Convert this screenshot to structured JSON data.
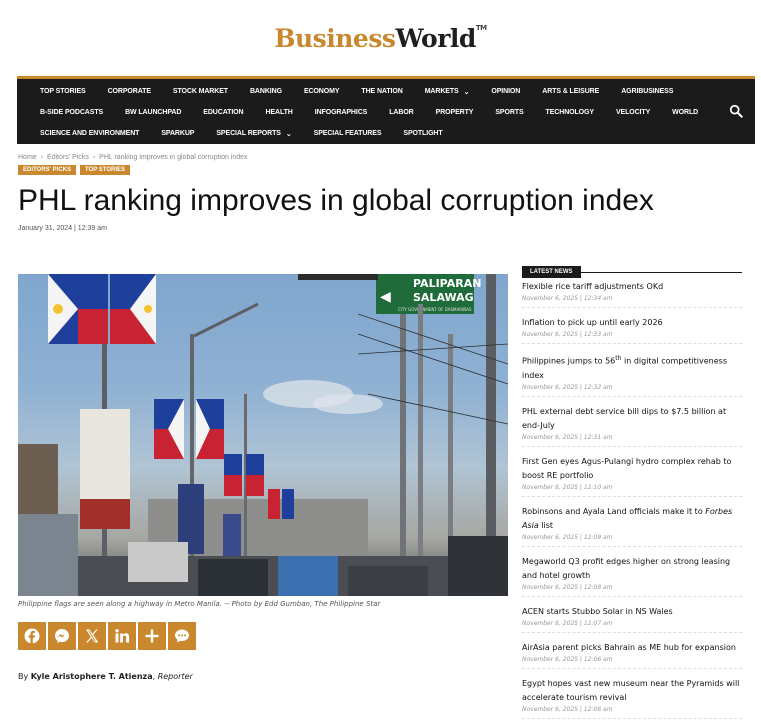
{
  "brand": {
    "part1": "Business",
    "part2": "World",
    "tm": "TM"
  },
  "nav": {
    "row1": [
      "TOP STORIES",
      "CORPORATE",
      "STOCK MARKET",
      "BANKING",
      "ECONOMY",
      "THE NATION",
      "MARKETS",
      "OPINION",
      "ARTS & LEISURE",
      "AGRIBUSINESS"
    ],
    "row2": [
      "B-SIDE PODCASTS",
      "BW LAUNCHPAD",
      "EDUCATION",
      "HEALTH",
      "INFOGRAPHICS",
      "LABOR",
      "PROPERTY",
      "SPORTS",
      "TECHNOLOGY",
      "VELOCITY",
      "WORLD"
    ],
    "row3": [
      "SCIENCE AND ENVIRONMENT",
      "SPARKUP",
      "SPECIAL REPORTS",
      "SPECIAL FEATURES",
      "SPOTLIGHT"
    ],
    "dropdown_caret": "⌄",
    "search_icon": "search-icon"
  },
  "breadcrumb": {
    "home": "Home",
    "section": "Editors' Picks",
    "current": "PHL ranking improves in global corruption index",
    "separator": "›"
  },
  "tags": [
    "EDITORS' PICKS",
    "TOP STORIES"
  ],
  "article": {
    "headline": "PHL ranking improves in global corruption index",
    "date": "January 31, 2024 | 12:39 am",
    "caption": "Philippine flags are seen along a highway in Metro Manila. -- Photo by Edd Gumban, The Philippine Star",
    "byline_prefix": "By",
    "author": "Kyle Aristophere T. Atienza",
    "role": "Reporter"
  },
  "photo": {
    "sign_line1": "PALIPARAN",
    "sign_line2": "SALAWAG",
    "sign_sub": "CITY GOVERNMENT OF DASMARIÑAS",
    "sign_arrow": "◀"
  },
  "share": [
    "facebook-icon",
    "messenger-icon",
    "x-icon",
    "linkedin-icon",
    "plus-icon",
    "chat-icon"
  ],
  "latest": {
    "label": "LATEST NEWS",
    "items": [
      {
        "title": "Flexible rice tariff adjustments OKd",
        "time": "November 6, 2025 | 12:34 am"
      },
      {
        "title": "Inflation to pick up until early 2026",
        "time": "November 6, 2025 | 12:33 am"
      },
      {
        "title_pre": "Philippines jumps to 56",
        "title_sup": "th",
        "title_post": " in digital competitiveness index",
        "time": "November 6, 2025 | 12:32 am"
      },
      {
        "title": "PHL external debt service bill dips to $7.5 billion at end-July",
        "time": "November 6, 2025 | 12:31 am"
      },
      {
        "title": "First Gen eyes Agus-Pulangi hydro complex rehab to boost RE portfolio",
        "time": "November 6, 2025 | 12:10 am"
      },
      {
        "title_pre": "Robinsons and Ayala Land officials make it to ",
        "title_em": "Forbes Asia",
        "title_post": " list",
        "time": "November 6, 2025 | 12:09 am"
      },
      {
        "title": "Megaworld Q3 profit edges higher on strong leasing and hotel growth",
        "time": "November 6, 2025 | 12:08 am"
      },
      {
        "title": "ACEN starts Stubbo Solar in NS Wales",
        "time": "November 6, 2025 | 12:07 am"
      },
      {
        "title": "AirAsia parent picks Bahrain as ME hub for expansion",
        "time": "November 6, 2025 | 12:06 am"
      },
      {
        "title": "Egypt hopes vast new museum near the Pyramids will accelerate tourism revival",
        "time": "November 6, 2025 | 12:06 am"
      }
    ]
  },
  "colors": {
    "accent": "#c9872e",
    "nav_bg": "#1b1b1b"
  }
}
